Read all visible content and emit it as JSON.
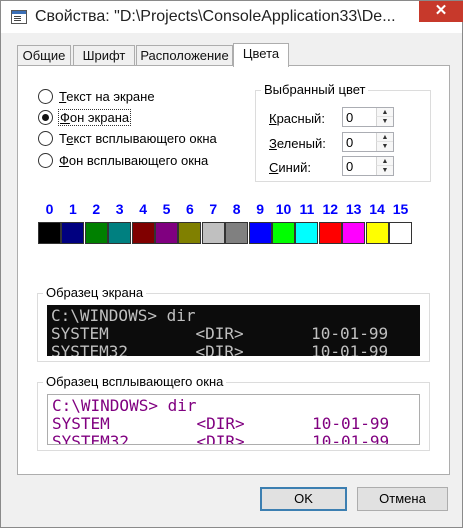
{
  "window": {
    "title": "Свойства: \"D:\\Projects\\ConsoleApplication33\\De...",
    "close_label": "✕"
  },
  "tabs": [
    {
      "label": "Общие"
    },
    {
      "label": "Шрифт"
    },
    {
      "label": "Расположение"
    },
    {
      "label": "Цвета"
    }
  ],
  "radios": [
    {
      "accel": "Т",
      "rest": "екст на экране",
      "checked": false
    },
    {
      "accel": "Ф",
      "rest": "он экрана",
      "checked": true
    },
    {
      "accel": "",
      "pre": "Т",
      "accel2": "е",
      "rest": "кст всплывающего окна",
      "checked": false
    },
    {
      "accel": "Ф",
      "rest": "он всплывающего окна",
      "checked": false
    }
  ],
  "selected_color": {
    "title": "Выбранный цвет",
    "red": {
      "accel": "К",
      "rest": "расный:",
      "value": "0"
    },
    "green": {
      "accel": "З",
      "rest": "еленый:",
      "value": "0"
    },
    "blue": {
      "accel": "С",
      "rest": "иний:",
      "value": "0"
    }
  },
  "palette": {
    "numbers": [
      "0",
      "1",
      "2",
      "3",
      "4",
      "5",
      "6",
      "7",
      "8",
      "9",
      "10",
      "11",
      "12",
      "13",
      "14",
      "15"
    ],
    "colors": [
      "#000000",
      "#000080",
      "#008000",
      "#008080",
      "#800000",
      "#800080",
      "#808000",
      "#c0c0c0",
      "#808080",
      "#0000ff",
      "#00ff00",
      "#00ffff",
      "#ff0000",
      "#ff00ff",
      "#ffff00",
      "#ffffff"
    ],
    "number_color": "#0000ff"
  },
  "screen_sample": {
    "title": "Образец экрана",
    "lines": [
      "C:\\WINDOWS> dir",
      "SYSTEM         <DIR>       10-01-99",
      "SYSTEM32       <DIR>       10-01-99"
    ],
    "background": "#0c0c0c",
    "text_color": "#c0c0c0"
  },
  "popup_sample": {
    "title": "Образец всплывающего окна",
    "lines": [
      "C:\\WINDOWS> dir",
      "SYSTEM         <DIR>       10-01-99",
      "SYSTEM32       <DIR>       10-01-99"
    ],
    "background": "#ffffff",
    "text_color": "#800080"
  },
  "buttons": {
    "ok": "OK",
    "cancel": "Отмена"
  }
}
